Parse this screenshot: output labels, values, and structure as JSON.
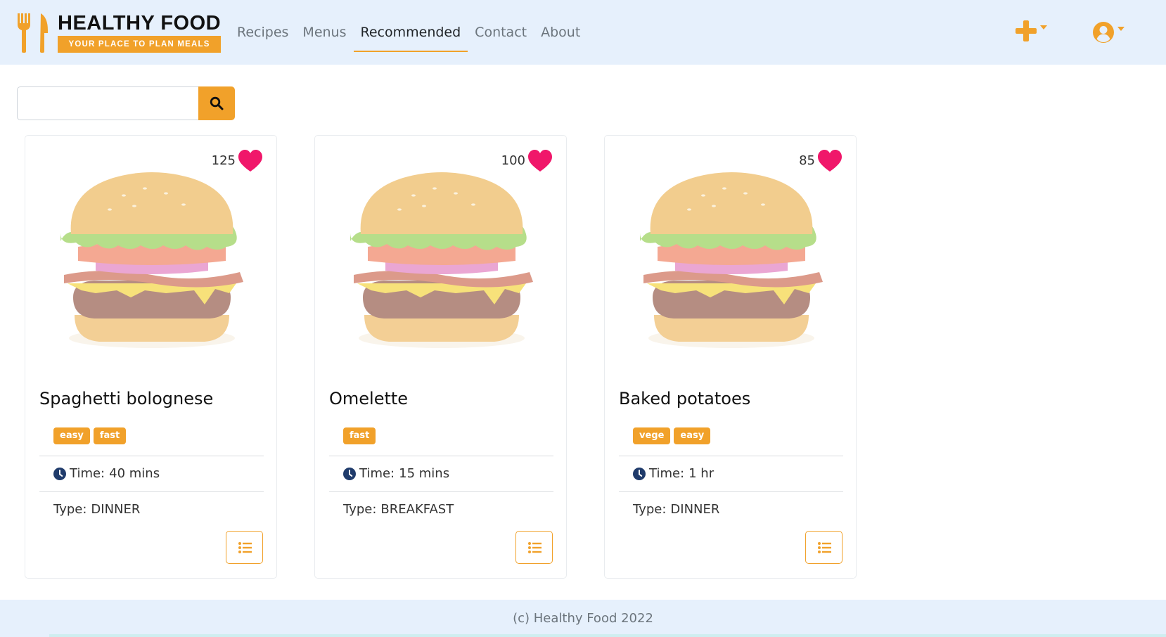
{
  "header": {
    "brand_title": "HEALTHY FOOD",
    "brand_tagline": "YOUR PLACE TO PLAN MEALS",
    "nav": [
      {
        "label": "Recipes",
        "active": false
      },
      {
        "label": "Menus",
        "active": false
      },
      {
        "label": "Recommended",
        "active": true
      },
      {
        "label": "Contact",
        "active": false
      },
      {
        "label": "About",
        "active": false
      }
    ],
    "add_icon": "plus-icon",
    "user_icon": "user-circle-icon"
  },
  "search": {
    "value": "",
    "placeholder": "",
    "button_icon": "search-icon"
  },
  "recipes": [
    {
      "likes": "125",
      "title": "Spaghetti bolognese",
      "tags": [
        "easy",
        "fast"
      ],
      "time_label": "Time:",
      "time_value": "40 mins",
      "type_label": "Type:",
      "type_value": "DINNER"
    },
    {
      "likes": "100",
      "title": "Omelette",
      "tags": [
        "fast"
      ],
      "time_label": "Time:",
      "time_value": "15 mins",
      "type_label": "Type:",
      "type_value": "BREAKFAST"
    },
    {
      "likes": "85",
      "title": "Baked potatoes",
      "tags": [
        "vege",
        "easy"
      ],
      "time_label": "Time:",
      "time_value": "1 hr",
      "type_label": "Type:",
      "type_value": "DINNER"
    }
  ],
  "footer": {
    "text": "(c) Healthy Food 2022"
  },
  "colors": {
    "accent": "#f1a12a",
    "navbar_bg": "#e6f0fc",
    "heart": "#f0176a",
    "clock": "#1f3b6b"
  }
}
